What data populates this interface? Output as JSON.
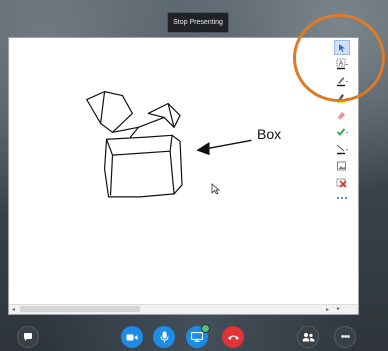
{
  "header": {
    "stop_presenting_label": "Stop Presenting"
  },
  "whiteboard": {
    "label_text": "Box",
    "tools": [
      {
        "name": "select-tool",
        "selected": true
      },
      {
        "name": "text-tool"
      },
      {
        "name": "pen-tool"
      },
      {
        "name": "highlighter-tool"
      },
      {
        "name": "eraser-tool"
      },
      {
        "name": "stamp-tool"
      },
      {
        "name": "arrow-line-tool"
      },
      {
        "name": "insert-image-tool"
      },
      {
        "name": "delete-tool"
      },
      {
        "name": "more-tool"
      }
    ],
    "colors": {
      "pen": "#111111",
      "highlighter": "#f3e03b",
      "stamp": "#2fa84f",
      "delete": "#d9352e",
      "accent": "#1e8ce6"
    }
  },
  "annotation": {
    "circle_color": "#e07a26"
  },
  "bottom_bar": {
    "buttons": [
      "chat",
      "video",
      "microphone",
      "present",
      "hang-up",
      "call-controls",
      "more-options"
    ]
  }
}
